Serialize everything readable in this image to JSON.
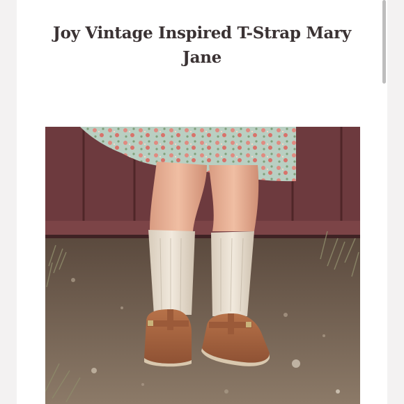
{
  "listing": {
    "title_line1": "Joy Vintage Inspired T-Strap Mary",
    "title_line2": "Jane"
  },
  "photo": {
    "subject": "child wearing brown T-strap Mary Jane shoes with cream knee socks and a floral dress, standing on dirt in front of a red wooden fence"
  },
  "colors": {
    "background": "#f3f2f2",
    "card": "#ffffff",
    "title_text": "#3a3233",
    "fence": "#6a3a3c",
    "shoe": "#a8653f"
  }
}
